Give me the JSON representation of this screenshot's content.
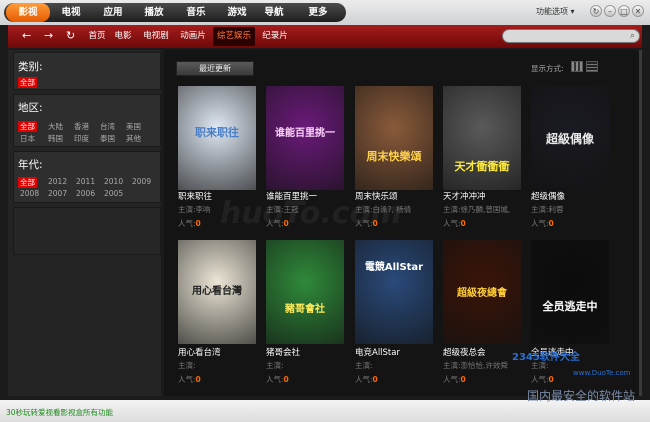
{
  "top_tabs": [
    "影视",
    "电视",
    "应用",
    "播放",
    "音乐",
    "游戏",
    "导航",
    "更多"
  ],
  "top_right": {
    "options_label": "功能选项 ▾",
    "icons": [
      "refresh-icon",
      "minimize-icon",
      "maximize-icon",
      "close-icon"
    ]
  },
  "nav": {
    "back": "←",
    "forward": "→",
    "refresh": "↻",
    "links": [
      "首页",
      "电影",
      "电视剧",
      "动画片",
      "综艺娱乐",
      "纪录片"
    ],
    "active_index": 4,
    "search_placeholder": ""
  },
  "filters": {
    "category": {
      "title": "类别:",
      "options": [
        "全部"
      ]
    },
    "region": {
      "title": "地区:",
      "options": [
        "全部",
        "大陆",
        "香港",
        "台湾",
        "美国",
        "日本",
        "韩国",
        "印度",
        "泰国",
        "其他"
      ]
    },
    "year": {
      "title": "年代:",
      "options": [
        "全部",
        "2012",
        "2011",
        "2010",
        "2009",
        "2008",
        "2007",
        "2006",
        "2005"
      ]
    }
  },
  "toolbar": {
    "latest_button": "最近更新",
    "display_mode_label": "显示方式:"
  },
  "labels": {
    "host": "主演:",
    "popularity": "人气:"
  },
  "cards": [
    {
      "title": "职来职往",
      "host": "李响",
      "pop": "0",
      "poster_text": "职来职往",
      "bg": "#dfe8f3",
      "fg": "#4a7fc8"
    },
    {
      "title": "谁能百里挑一",
      "host": "王冠",
      "pop": "0",
      "poster_text": "谁能百里挑一",
      "bg": "#6b1a7a",
      "fg": "#ffd6ff"
    },
    {
      "title": "周末快乐颂",
      "host": "白泳?, 杨倩",
      "pop": "0",
      "poster_text": "周末快樂頌",
      "bg": "#8a5a3a",
      "fg": "#ffd34a"
    },
    {
      "title": "天才冲冲冲",
      "host": "徐乃麟,曾国城,",
      "pop": "0",
      "poster_text": "天才衝衝衝",
      "bg": "#5a5a5a",
      "fg": "#ffea3a"
    },
    {
      "title": "超级偶像",
      "host": "利蓉",
      "pop": "0",
      "poster_text": "超級偶像",
      "bg": "#1a1a22",
      "fg": "#e8e8e8"
    },
    {
      "title": "用心看台湾",
      "host": "",
      "pop": "0",
      "poster_text": "用心看台灣",
      "bg": "#ece6d6",
      "fg": "#222"
    },
    {
      "title": "猪哥会社",
      "host": "",
      "pop": "0",
      "poster_text": "豬哥會社",
      "bg": "#2f8a3a",
      "fg": "#ffea5a"
    },
    {
      "title": "电竞AllStar",
      "host": "",
      "pop": "0",
      "poster_text": "電競AllStar",
      "bg": "#2a4a7a",
      "fg": "#ffffff"
    },
    {
      "title": "超级夜总会",
      "host": "澎恰恰,许效舜",
      "pop": "0",
      "poster_text": "超級夜總會",
      "bg": "#3a1408",
      "fg": "#ffcf3a"
    },
    {
      "title": "全员逃走中",
      "host": "",
      "pop": "0",
      "poster_text": "全员逃走中",
      "bg": "#0c0c0c",
      "fg": "#ffffff"
    }
  ],
  "watermark": "huoTo.com",
  "status": {
    "text": "30秒玩转爱视看影视盒所有功能"
  },
  "corner_logo": {
    "site": "2345软件大全",
    "url": "www.DuoTe.com",
    "slogan": "国内最安全的软件站"
  },
  "colors": {
    "accent": "#ff7a1a",
    "nav_red": "#a51c1c",
    "selected": "#e00000",
    "popularity": "#ff6a00"
  }
}
